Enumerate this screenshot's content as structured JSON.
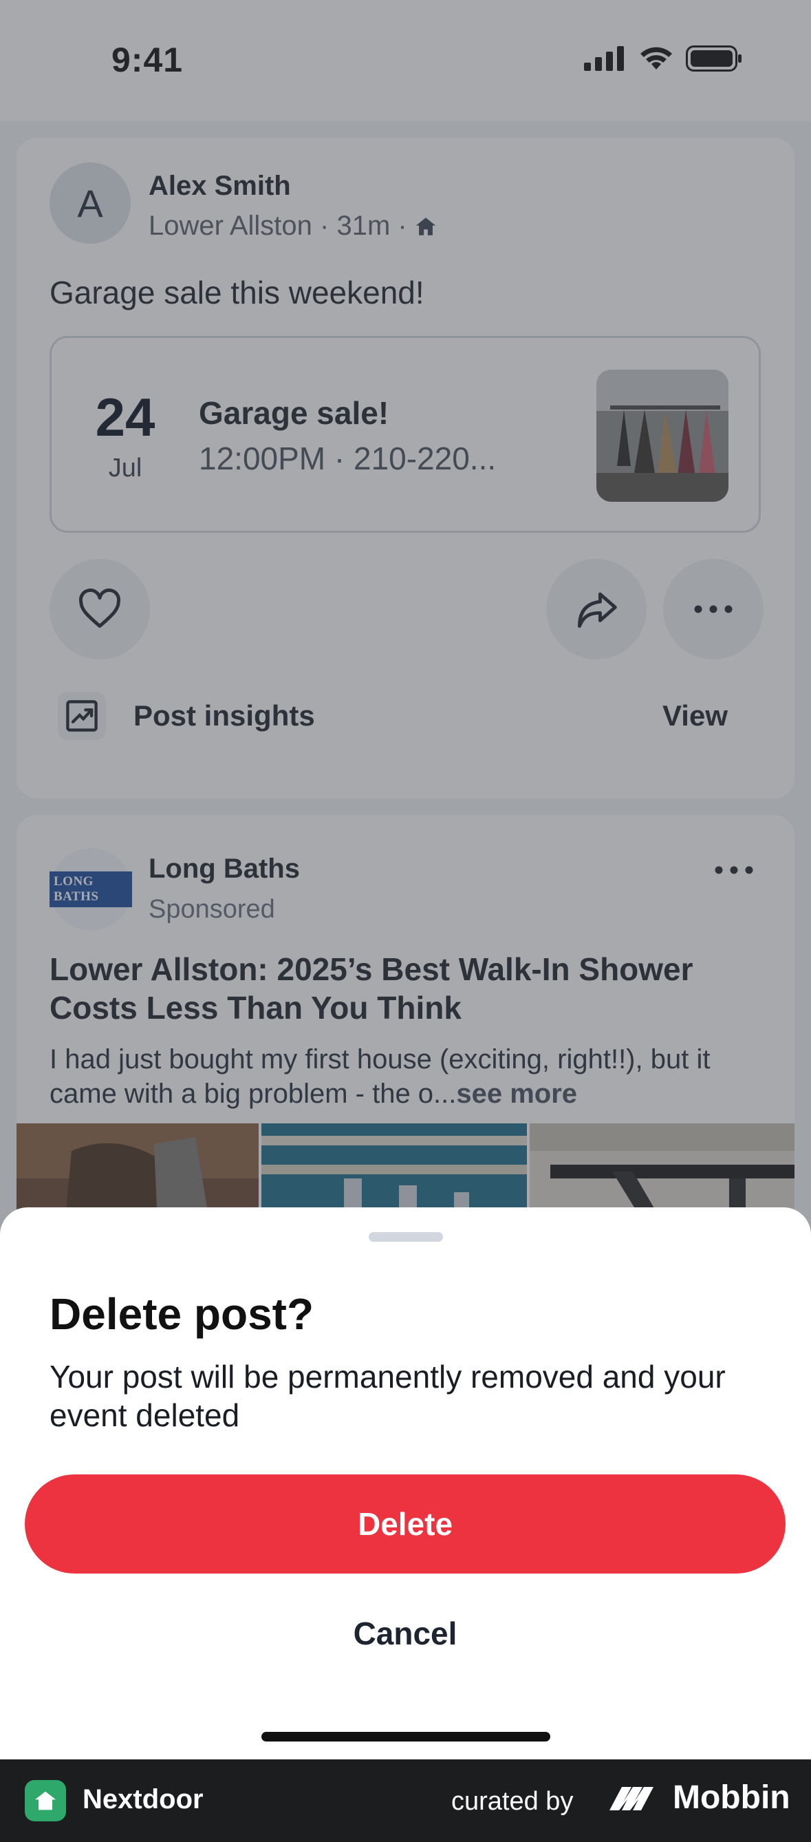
{
  "status_bar": {
    "time": "9:41"
  },
  "post": {
    "avatar_initial": "A",
    "author": "Alex Smith",
    "meta": "Lower Allston · 31m ·",
    "text": "Garage sale this weekend!",
    "event": {
      "day": "24",
      "month": "Jul",
      "title": "Garage sale!",
      "subtitle": "12:00PM · 210-220..."
    },
    "insights_label": "Post insights",
    "insights_action": "View"
  },
  "ad": {
    "logo_text": "LONG BATHS",
    "advertiser": "Long Baths",
    "sponsored": "Sponsored",
    "headline": "Lower Allston: 2025’s Best Walk-In Shower Costs Less Than You Think",
    "body": "I had just bought my first house (exciting, right!!), but it came with a big problem - the o...",
    "see_more": "see more"
  },
  "sheet": {
    "title": "Delete post?",
    "body": "Your post will be permanently removed and your event deleted",
    "delete_label": "Delete",
    "cancel_label": "Cancel"
  },
  "footer": {
    "app_name": "Nextdoor",
    "curated_by": "curated by",
    "brand": "Mobbin"
  },
  "colors": {
    "danger": "#ed3340",
    "dim_overlay": "rgba(60,64,70,0.45)",
    "nextdoor_green": "#2ea96b"
  }
}
